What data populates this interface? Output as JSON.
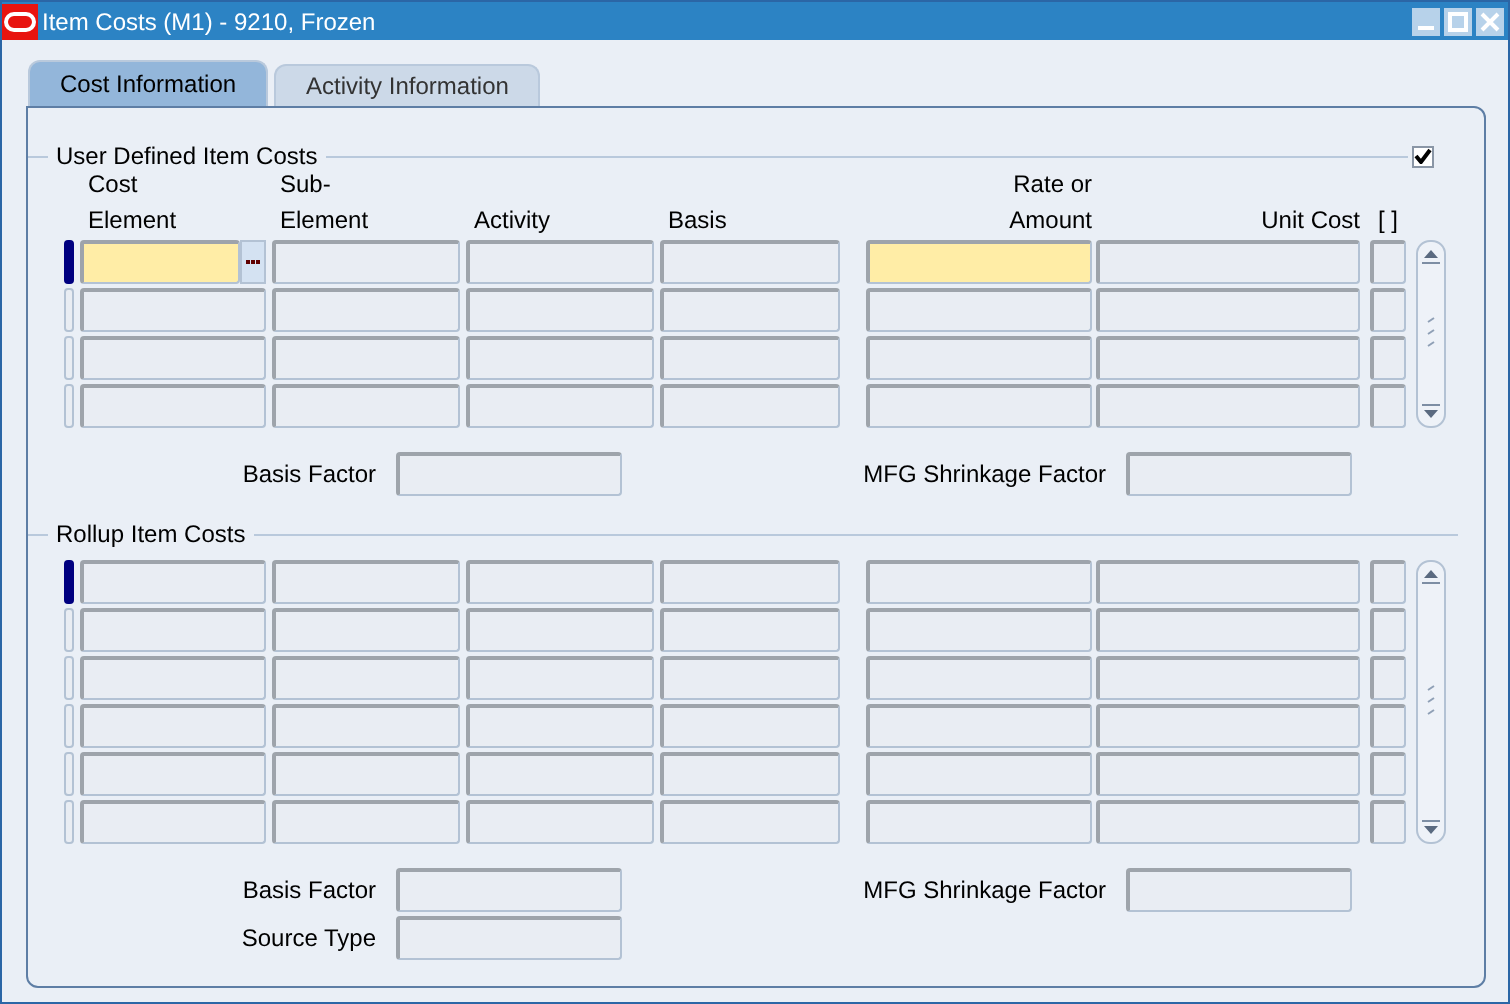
{
  "window": {
    "title": "Item Costs (M1) - 9210, Frozen"
  },
  "tabs": [
    {
      "label": "Cost Information",
      "selected": true
    },
    {
      "label": "Activity Information",
      "selected": false
    }
  ],
  "sections": [
    {
      "title": "User Defined Item Costs",
      "checkbox": {
        "checked": true
      },
      "columns": [
        {
          "label": [
            "Cost",
            "Element"
          ]
        },
        {
          "label": [
            "Sub-",
            "Element"
          ]
        },
        {
          "label": [
            "Activity"
          ]
        },
        {
          "label": [
            "Basis"
          ]
        },
        {
          "label": [
            "Rate or",
            "Amount"
          ]
        },
        {
          "label": [
            "Unit Cost"
          ]
        },
        {
          "label": [
            "[ ]"
          ]
        }
      ],
      "rows": [
        {
          "selected": true,
          "highlighted": true
        },
        {
          "selected": false,
          "highlighted": false
        },
        {
          "selected": false,
          "highlighted": false
        },
        {
          "selected": false,
          "highlighted": false
        }
      ],
      "left_fields": [
        {
          "label": "Basis Factor"
        }
      ],
      "right_fields": [
        {
          "label": "MFG Shrinkage Factor"
        }
      ]
    },
    {
      "title": "Rollup Item Costs",
      "rows": [
        {
          "selected": true,
          "highlighted": false
        },
        {
          "selected": false,
          "highlighted": false
        },
        {
          "selected": false,
          "highlighted": false
        },
        {
          "selected": false,
          "highlighted": false
        },
        {
          "selected": false,
          "highlighted": false
        },
        {
          "selected": false,
          "highlighted": false
        }
      ],
      "left_fields": [
        {
          "label": "Basis Factor"
        },
        {
          "label": "Source Type"
        }
      ],
      "right_fields": [
        {
          "label": "MFG Shrinkage Factor"
        }
      ]
    }
  ]
}
